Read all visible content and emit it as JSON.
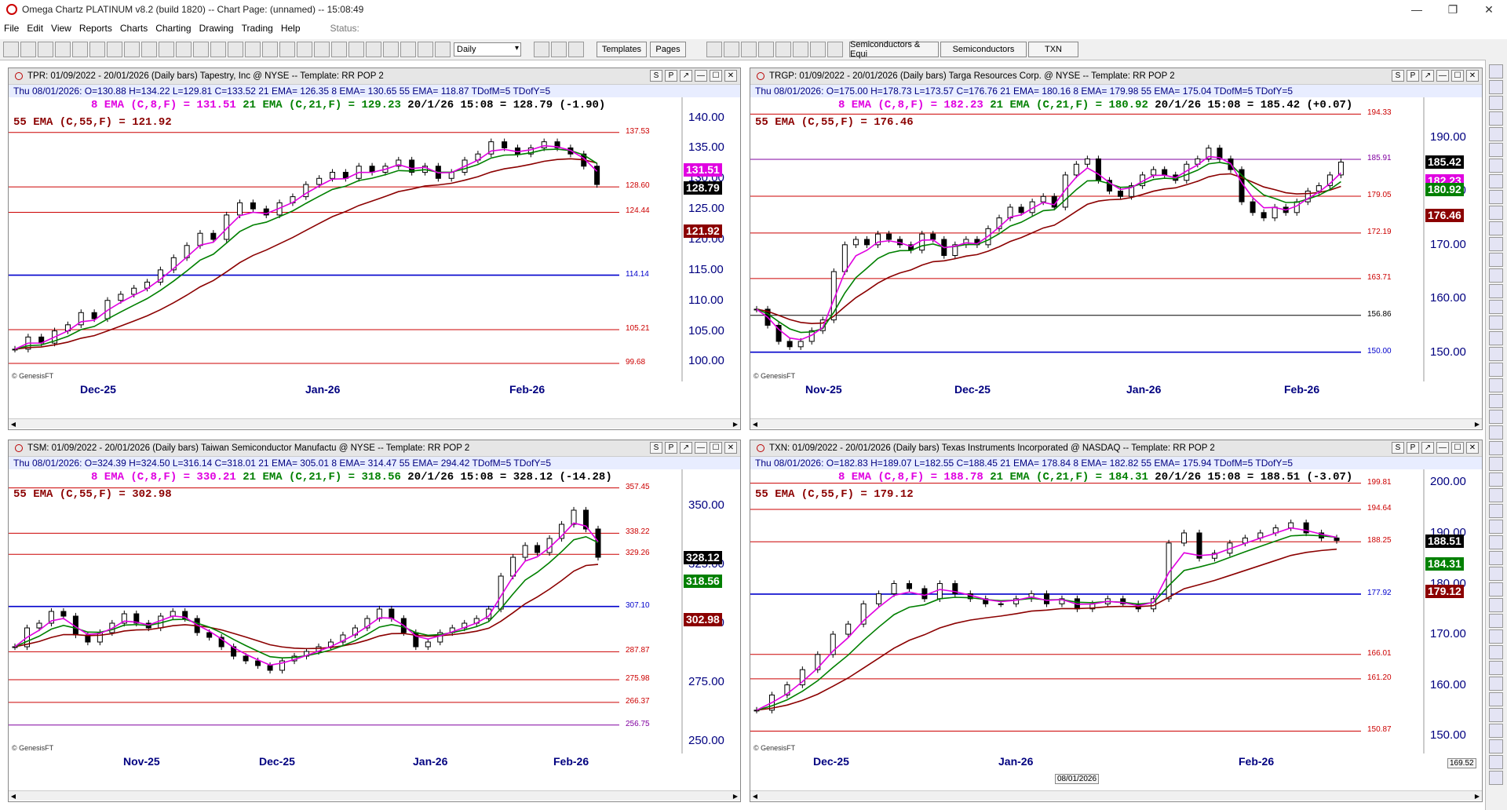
{
  "app": {
    "title": "Omega Chartz PLATINUM v8.2 (build 1820)  --  Chart Page: (unnamed)  --  15:08:49",
    "menu": [
      "File",
      "Edit",
      "View",
      "Reports",
      "Charts",
      "Charting",
      "Drawing",
      "Trading",
      "Help"
    ],
    "status_label": "Status:",
    "interval": "Daily",
    "toolbar_text": {
      "templates": "Templates",
      "pages": "Pages",
      "semis_equi": "Semiconductors & Equi",
      "semis": "Semiconductors",
      "txn": "TXN"
    },
    "genesis": "© GenesisFT",
    "date_tip": "08/01/2026",
    "cursor_value": "169.52"
  },
  "colors": {
    "magenta": "#e000e0",
    "green": "#008000",
    "darkred": "#8b0000",
    "navy": "#000080",
    "redline": "#cc0000",
    "blueline": "#0000cc"
  },
  "charts": [
    {
      "id": "TPR",
      "title": "TPR: 01/09/2022 - 20/01/2026  (Daily bars)   Tapestry, Inc @ NYSE  --  Template: RR POP 2",
      "ohlc": "Thu   08/01/2026:  O=130.88  H=134.22  L=129.81  C=133.52  21 EMA= 126.35  8 EMA= 130.65  55 EMA= 118.87  TDofM=5  TDofY=5",
      "ema8_text": "8 EMA (C,8,F) = 131.51",
      "ema21_text": "21 EMA (C,21,F) = 129.23",
      "last_text": "20/1/26 15:08 = 128.79 (-1.90)",
      "ema55_text": "55 EMA (C,55,F) = 121.92",
      "x_labels": [
        "Dec-25",
        "Jan-26",
        "Feb-26"
      ],
      "price_labels": [
        "140.00",
        "135.00",
        "130.00",
        "125.00",
        "120.00",
        "115.00",
        "110.00",
        "105.00",
        "100.00"
      ],
      "hlines": [
        {
          "label": "137.53",
          "color": "red"
        },
        {
          "label": "128.60",
          "color": "red"
        },
        {
          "label": "124.44",
          "color": "red"
        },
        {
          "label": "114.14",
          "color": "blue"
        },
        {
          "label": "105.21",
          "color": "red"
        },
        {
          "label": "99.68",
          "color": "red"
        }
      ],
      "tags": [
        {
          "text": "131.51",
          "color": "#e000e0"
        },
        {
          "text": "128.79",
          "color": "#000000"
        },
        {
          "text": "121.92",
          "color": "#8b0000"
        }
      ]
    },
    {
      "id": "TRGP",
      "title": "TRGP: 01/09/2022 - 20/01/2026  (Daily bars)   Targa Resources Corp. @ NYSE  --  Template: RR POP 2",
      "ohlc": "Thu   08/01/2026:  O=175.00  H=178.73  L=173.57  C=176.76  21 EMA= 180.16  8 EMA= 179.98  55 EMA= 175.04  TDofM=5  TDofY=5",
      "ema8_text": "8 EMA (C,8,F) = 182.23",
      "ema21_text": "21 EMA (C,21,F) = 180.92",
      "last_text": "20/1/26 15:08 = 185.42 (+0.07)",
      "ema55_text": "55 EMA (C,55,F) = 176.46",
      "x_labels": [
        "Nov-25",
        "Dec-25",
        "Jan-26",
        "Feb-26"
      ],
      "price_labels": [
        "190.00",
        "180.00",
        "170.00",
        "160.00",
        "150.00"
      ],
      "hlines": [
        {
          "label": "194.33",
          "color": "red"
        },
        {
          "label": "185.91",
          "color": "purple"
        },
        {
          "label": "179.05",
          "color": "red"
        },
        {
          "label": "172.19",
          "color": "red"
        },
        {
          "label": "163.71",
          "color": "red"
        },
        {
          "label": "156.86",
          "color": "black"
        },
        {
          "label": "150.00",
          "color": "blue"
        }
      ],
      "tags": [
        {
          "text": "185.42",
          "color": "#000000"
        },
        {
          "text": "182.23",
          "color": "#e000e0"
        },
        {
          "text": "180.92",
          "color": "#008000"
        },
        {
          "text": "176.46",
          "color": "#8b0000"
        }
      ]
    },
    {
      "id": "TSM",
      "title": "TSM: 01/09/2022 - 20/01/2026  (Daily bars)   Taiwan Semiconductor Manufactu @ NYSE  --  Template: RR POP 2",
      "ohlc": "Thu   08/01/2026:  O=324.39  H=324.50  L=316.14  C=318.01  21 EMA= 305.01  8 EMA= 314.47  55 EMA= 294.42  TDofM=5  TDofY=5",
      "ema8_text": "8 EMA (C,8,F) = 330.21",
      "ema21_text": "21 EMA (C,21,F) = 318.56",
      "last_text": "20/1/26 15:08 = 328.12 (-14.28)",
      "ema55_text": "55 EMA (C,55,F) = 302.98",
      "x_labels": [
        "Nov-25",
        "Dec-25",
        "Jan-26",
        "Feb-26"
      ],
      "price_labels": [
        "350.00",
        "325.00",
        "300.00",
        "275.00",
        "250.00"
      ],
      "hlines": [
        {
          "label": "357.45",
          "color": "red"
        },
        {
          "label": "338.22",
          "color": "red"
        },
        {
          "label": "329.26",
          "color": "red"
        },
        {
          "label": "307.10",
          "color": "blue"
        },
        {
          "label": "287.87",
          "color": "red"
        },
        {
          "label": "275.98",
          "color": "red"
        },
        {
          "label": "266.37",
          "color": "red"
        },
        {
          "label": "256.75",
          "color": "purple"
        }
      ],
      "tags": [
        {
          "text": "328.12",
          "color": "#000000"
        },
        {
          "text": "318.56",
          "color": "#008000"
        },
        {
          "text": "302.98",
          "color": "#8b0000"
        }
      ]
    },
    {
      "id": "TXN",
      "title": "TXN: 01/09/2022 - 20/01/2026  (Daily bars)   Texas Instruments Incorporated @ NASDAQ  --  Template: RR POP 2",
      "ohlc": "Thu   08/01/2026:  O=182.83  H=189.07  L=182.55  C=188.45  21 EMA= 178.84  8 EMA= 182.82  55 EMA= 175.94  TDofM=5  TDofY=5",
      "ema8_text": "8 EMA (C,8,F) = 188.78",
      "ema21_text": "21 EMA (C,21,F) = 184.31",
      "last_text": "20/1/26 15:08 = 188.51 (-3.07)",
      "ema55_text": "55 EMA (C,55,F) = 179.12",
      "x_labels": [
        "Dec-25",
        "Jan-26",
        "Feb-26"
      ],
      "price_labels": [
        "200.00",
        "190.00",
        "180.00",
        "170.00",
        "160.00",
        "150.00"
      ],
      "hlines": [
        {
          "label": "199.81",
          "color": "red"
        },
        {
          "label": "194.64",
          "color": "red"
        },
        {
          "label": "188.25",
          "color": "red"
        },
        {
          "label": "177.92",
          "color": "blue"
        },
        {
          "label": "166.01",
          "color": "red"
        },
        {
          "label": "161.20",
          "color": "red"
        },
        {
          "label": "150.87",
          "color": "red"
        }
      ],
      "tags": [
        {
          "text": "188.51",
          "color": "#000000"
        },
        {
          "text": "184.31",
          "color": "#008000"
        },
        {
          "text": "179.12",
          "color": "#8b0000"
        }
      ]
    }
  ]
}
